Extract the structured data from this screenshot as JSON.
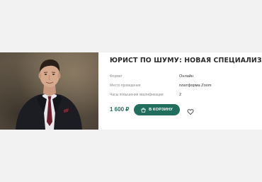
{
  "course": {
    "title": "ЮРИСТ ПО ШУМУ: НОВАЯ СПЕЦИАЛИЗАЦИЯ",
    "props": [
      {
        "label": "Формат",
        "value": "Онлайн"
      },
      {
        "label": "Место проведения",
        "value": "платформа Zoom"
      },
      {
        "label": "Часы повышения квалификации",
        "value": "2"
      }
    ],
    "price": "1 600 ₽",
    "cart_label": "В КОРЗИНУ"
  },
  "icons": {
    "cart": "cart-icon",
    "favorite": "heart-icon"
  },
  "colors": {
    "accent": "#1f6f5c",
    "page_background": "#f2f2f2",
    "card_background": "#ffffff",
    "title": "#2b2b2b",
    "label": "#8c8c8c"
  }
}
